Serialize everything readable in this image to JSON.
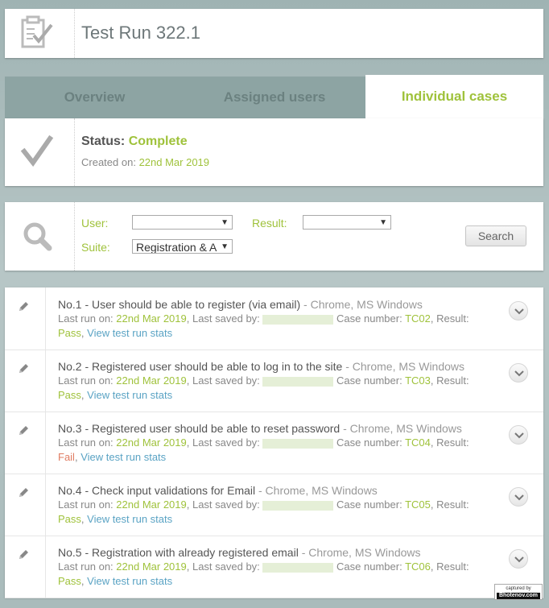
{
  "header": {
    "title": "Test Run 322.1",
    "icon": "clipboard-check-icon"
  },
  "tabs": [
    {
      "label": "Overview",
      "active": false
    },
    {
      "label": "Assigned users",
      "active": false
    },
    {
      "label": "Individual cases",
      "active": true
    }
  ],
  "status": {
    "label": "Status:",
    "value": "Complete",
    "created_label": "Created on:",
    "created_value": "22nd Mar 2019",
    "icon": "checkmark-icon"
  },
  "filter": {
    "icon": "search-icon",
    "user_label": "User:",
    "user_value": "",
    "result_label": "Result:",
    "result_value": "",
    "suite_label": "Suite:",
    "suite_value": "Registration & A",
    "search_button": "Search"
  },
  "cases": [
    {
      "title": "No.1 - User should be able to register (via email)",
      "env": " - Chrome, MS Windows",
      "last_run_label": "Last run on:",
      "last_run": "22nd Mar 2019",
      "saved_label": ", Last saved by:",
      "case_label": "Case number:",
      "case_number": "TC02",
      "result_label": ", Result:",
      "result": "Pass",
      "stats_link": "View test run stats"
    },
    {
      "title": "No.2 - Registered user should be able to log in to the site",
      "env": " - Chrome, MS Windows",
      "last_run_label": "Last run on:",
      "last_run": "22nd Mar 2019",
      "saved_label": ", Last saved by:",
      "case_label": "Case number:",
      "case_number": "TC03",
      "result_label": ", Result:",
      "result": "Pass",
      "stats_link": "View test run stats"
    },
    {
      "title": "No.3 - Registered user should be able to reset password",
      "env": " - Chrome, MS Windows",
      "last_run_label": "Last run on:",
      "last_run": "22nd Mar 2019",
      "saved_label": ", Last saved by:",
      "case_label": "Case number:",
      "case_number": "TC04",
      "result_label": ", Result:",
      "result": "Fail",
      "stats_link": "View test run stats"
    },
    {
      "title": "No.4 - Check input validations for Email",
      "env": " - Chrome, MS Windows",
      "last_run_label": "Last run on:",
      "last_run": "22nd Mar 2019",
      "saved_label": ", Last saved by:",
      "case_label": "Case number:",
      "case_number": "TC05",
      "result_label": ", Result:",
      "result": "Pass",
      "stats_link": "View test run stats"
    },
    {
      "title": "No.5 - Registration with already registered email",
      "env": " - Chrome, MS Windows",
      "last_run_label": "Last run on:",
      "last_run": "22nd Mar 2019",
      "saved_label": ", Last saved by:",
      "case_label": "Case number:",
      "case_number": "TC06",
      "result_label": ", Result:",
      "result": "Pass",
      "stats_link": "View test run stats"
    }
  ],
  "badge": {
    "line1": "captured by",
    "line2": "Bhotenov.com"
  },
  "colors": {
    "accent": "#9fc23b",
    "fail": "#e07d63",
    "link": "#5aa3c4",
    "tab_bar": "#8da4a3"
  }
}
